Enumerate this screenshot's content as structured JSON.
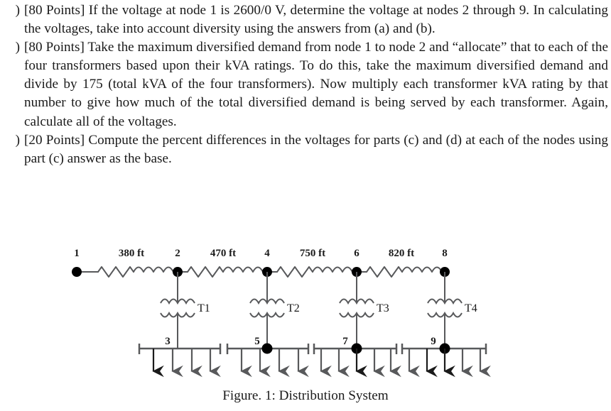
{
  "document": {
    "problems": [
      {
        "marker": ")",
        "text": "[80 Points] If the voltage at node 1 is 2600/0 V, determine the voltage at nodes 2 through 9. In calculating the voltages, take into account diversity using the answers from (a) and (b)."
      },
      {
        "marker": ")",
        "text": "[80 Points] Take the maximum diversified demand from node 1 to node 2 and “allocate” that to each of the four transformers based upon their kVA ratings. To do this, take the maximum diversified demand and divide by 175 (total kVA of the four transformers). Now multiply each transformer kVA rating by that number to give how much of the total diversified demand is being served by each transformer. Again, calculate all of the voltages."
      },
      {
        "marker": ")",
        "text": "[20 Points] Compute the percent differences in the voltages for parts (c) and (d) at each of the nodes using part (c) answer as the base."
      }
    ],
    "figure": {
      "caption": "Figure. 1: Distribution System",
      "primary_nodes": [
        "1",
        "2",
        "4",
        "6",
        "8"
      ],
      "span_labels": [
        "380 ft",
        "470 ft",
        "750 ft",
        "820 ft"
      ],
      "transformers": [
        "T1",
        "T2",
        "T3",
        "T4"
      ],
      "secondary_nodes": [
        "3",
        "5",
        "7",
        "9"
      ],
      "load_counts": [
        4,
        4,
        5,
        5
      ],
      "colors": {
        "line": "#58595b",
        "node": "#000000",
        "text": "#1a1a1a",
        "arrow": "#58595b"
      }
    }
  }
}
